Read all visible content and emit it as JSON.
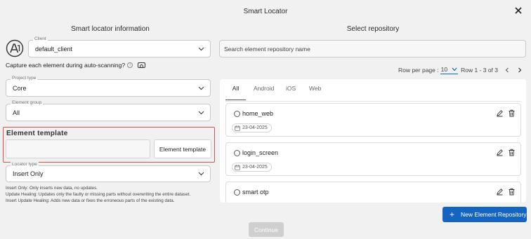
{
  "dialog": {
    "title": "Smart Locator"
  },
  "left": {
    "heading": "Smart locator information",
    "client": {
      "label": "Client",
      "value": "default_client"
    },
    "capture_label": "Capture each element during auto-scanning?",
    "capture_info_glyph": "i",
    "project_type": {
      "label": "Project type",
      "value": "Core"
    },
    "element_group": {
      "label": "Element group",
      "value": "All"
    },
    "template": {
      "title": "Element template",
      "input_value": "",
      "button_label": "Element template"
    },
    "locator_type": {
      "label": "Locator type",
      "value": "Insert Only"
    },
    "notes": [
      "Insert Only: Only inserts new data, no updates.",
      "Update Healing: Updates only the faulty or missing parts without overwriting the entire dataset.",
      "Insert Update Healing: Adds new data or fixes the erroneous parts of the existing data."
    ]
  },
  "right": {
    "heading": "Select repository",
    "search_placeholder": "Search element repository name",
    "pager": {
      "rows_label": "Row per page :",
      "per_page": "10",
      "range": "Row 1 - 3 of 3"
    },
    "tabs": [
      {
        "label": "All",
        "active": true
      },
      {
        "label": "Android",
        "active": false
      },
      {
        "label": "iOS",
        "active": false
      },
      {
        "label": "Web",
        "active": false
      }
    ],
    "repositories": [
      {
        "name": "home_web",
        "date": "23-04-2025"
      },
      {
        "name": "login_screen",
        "date": "23-04-2025"
      },
      {
        "name": "smart otp",
        "date": ""
      }
    ],
    "new_button_label": "New Element Repository",
    "new_button_icon": "plus-icon"
  },
  "footer": {
    "continue_label": "Continue"
  },
  "colors": {
    "primary": "#1565c0",
    "highlight_border": "#e05252",
    "disabled": "#cfcfcf",
    "background": "#f1f1f1"
  }
}
